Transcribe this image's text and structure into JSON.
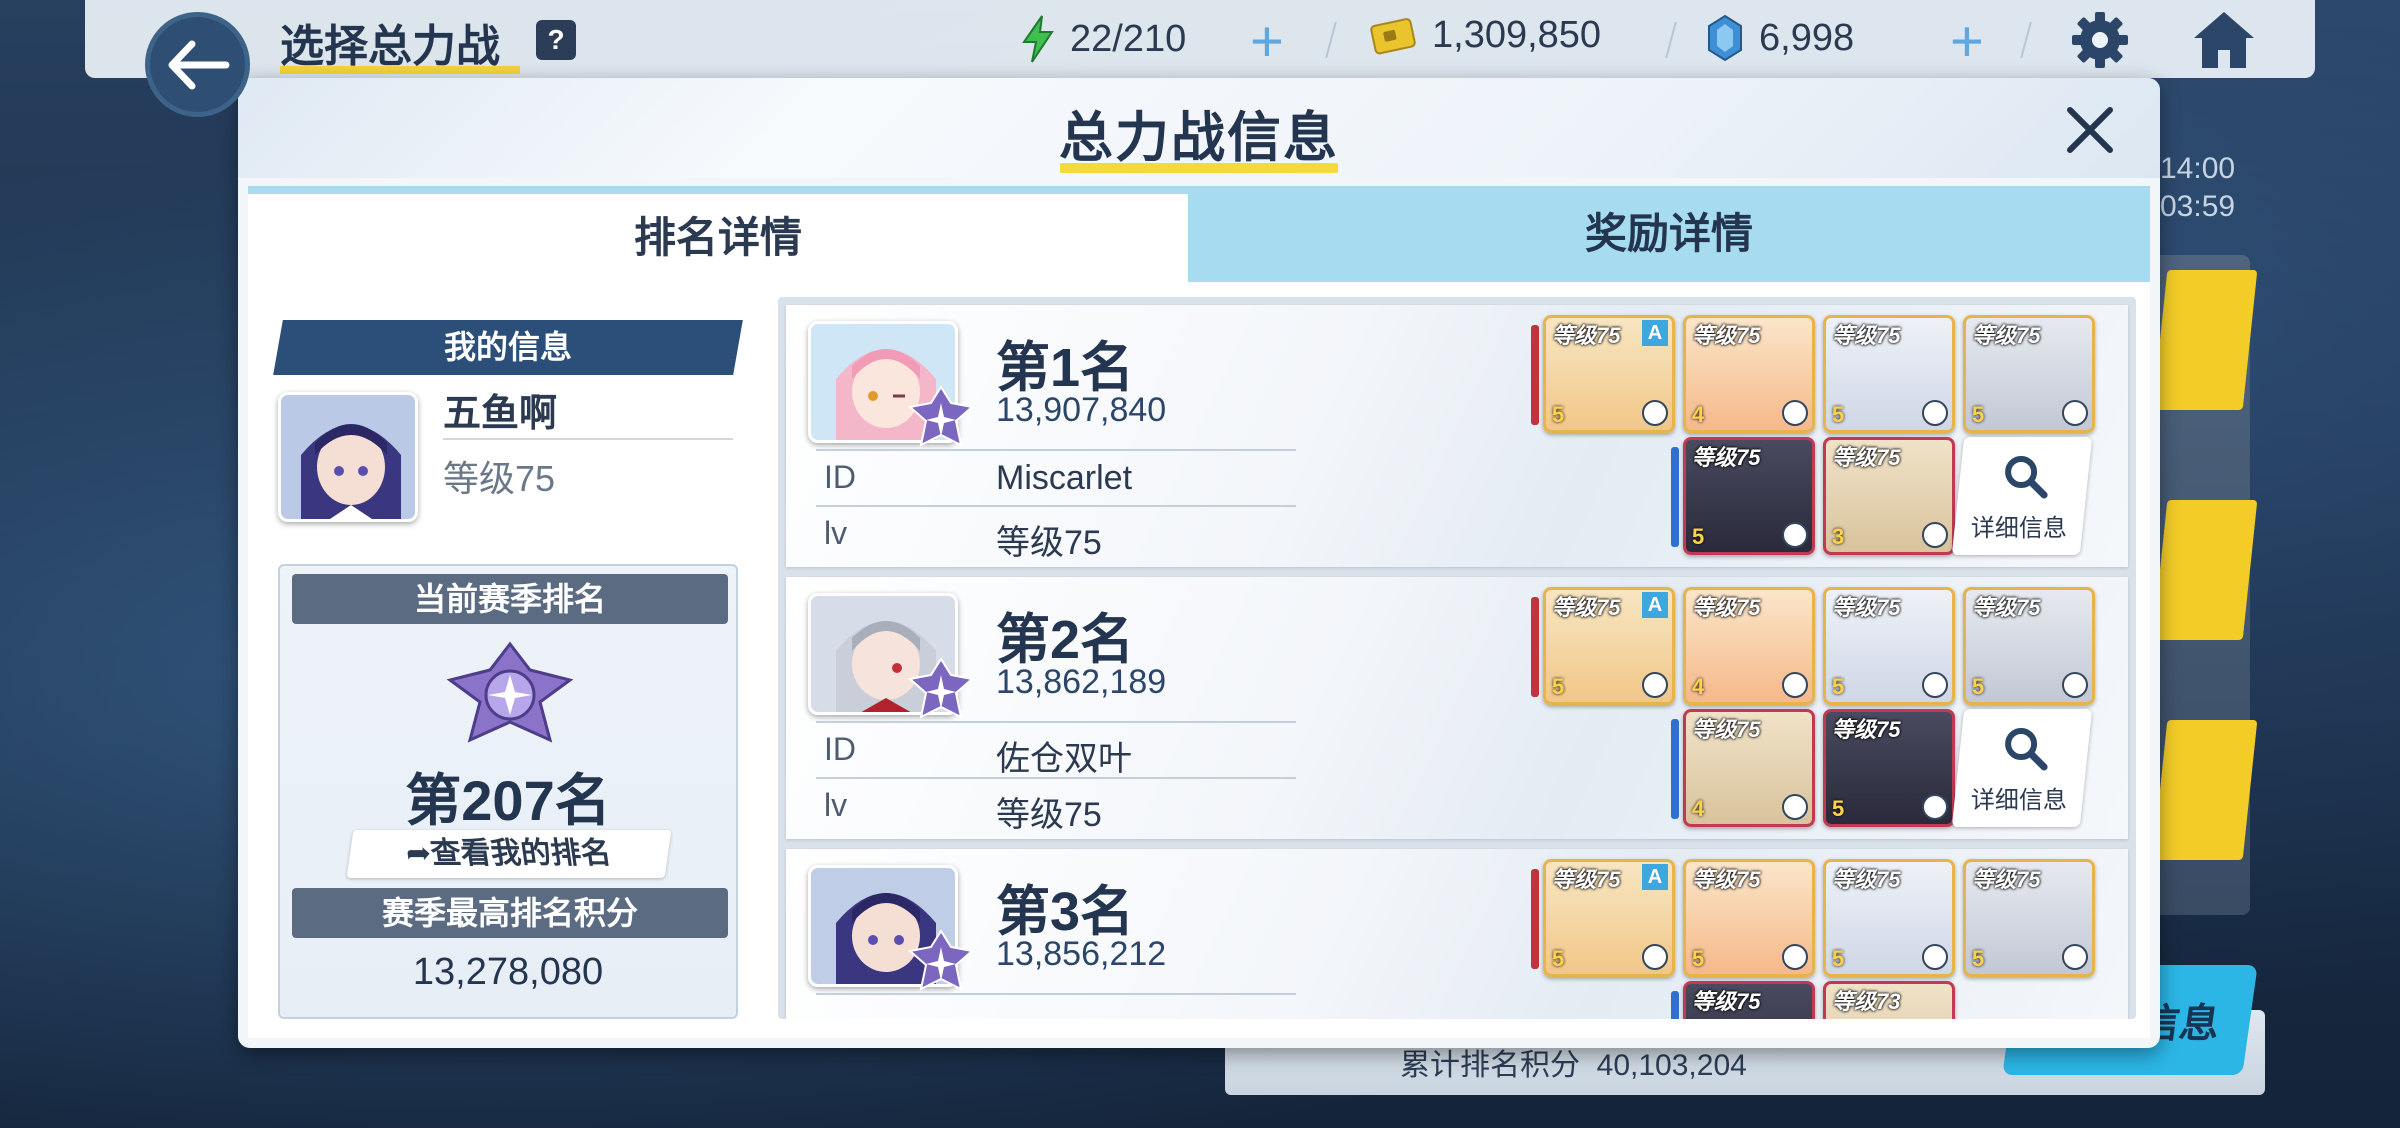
{
  "topbar": {
    "title": "选择总力战",
    "help": "?",
    "ap": "22/210",
    "credits": "1,309,850",
    "gems": "6,998"
  },
  "background": {
    "time_1": "14:00",
    "time_2": "03:59",
    "bottom_label": "累计排名积分",
    "bottom_value": "40,103,204",
    "bottom_button": "信息"
  },
  "modal": {
    "title": "总力战信息",
    "tabs": [
      "排名详情",
      "奖励详情"
    ]
  },
  "my_info": {
    "header": "我的信息",
    "name": "五鱼啊",
    "level": "等级75",
    "season_rank_label": "当前赛季排名",
    "season_rank": "第207名",
    "view_rank_button": "查看我的排名",
    "best_score_label": "赛季最高排名积分",
    "best_score": "13,278,080"
  },
  "ranking": {
    "id_label": "ID",
    "lv_label": "lv",
    "detail_label": "详细信息",
    "entries": [
      {
        "rank": "第1名",
        "score": "13,907,840",
        "id": "Miscarlet",
        "lv": "等级75",
        "team": [
          {
            "level": "等级75",
            "star": "5",
            "tag": "A"
          },
          {
            "level": "等级75",
            "star": "4"
          },
          {
            "level": "等级75",
            "star": "5"
          },
          {
            "level": "等级75",
            "star": "5"
          },
          {
            "level": "等级75",
            "star": "5"
          },
          {
            "level": "等级75",
            "star": "3"
          }
        ]
      },
      {
        "rank": "第2名",
        "score": "13,862,189",
        "id": "佐仓双叶",
        "lv": "等级75",
        "team": [
          {
            "level": "等级75",
            "star": "5",
            "tag": "A"
          },
          {
            "level": "等级75",
            "star": "4"
          },
          {
            "level": "等级75",
            "star": "5"
          },
          {
            "level": "等级75",
            "star": "5"
          },
          {
            "level": "等级75",
            "star": "4"
          },
          {
            "level": "等级75",
            "star": "5"
          }
        ]
      },
      {
        "rank": "第3名",
        "score": "13,856,212",
        "team": [
          {
            "level": "等级75",
            "star": "5",
            "tag": "A"
          },
          {
            "level": "等级75",
            "star": "5"
          },
          {
            "level": "等级75",
            "star": "5"
          },
          {
            "level": "等级75",
            "star": "5"
          },
          {
            "level": "等级75",
            "star": ""
          },
          {
            "level": "等级73",
            "star": ""
          }
        ]
      }
    ]
  },
  "colors": {
    "accent_blue": "#2b4f78",
    "tab_inactive": "#a7dcf0",
    "title_underline": "#f3d93a"
  }
}
